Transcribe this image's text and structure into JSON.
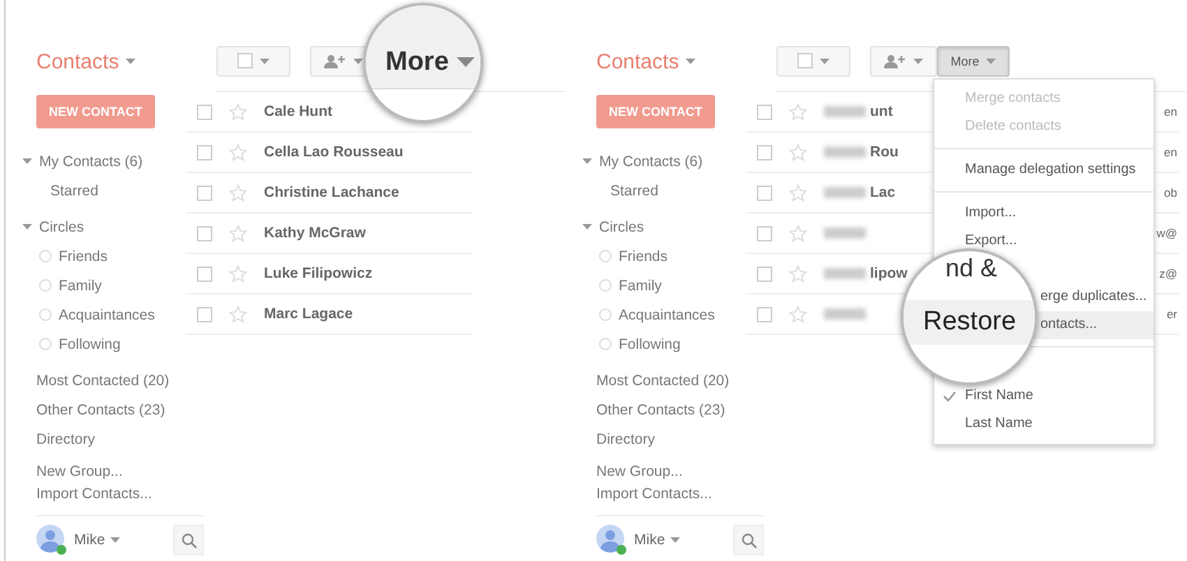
{
  "panels": [
    {
      "logo": "Contacts",
      "new_contact": "NEW CONTACT",
      "sidebar": [
        {
          "kind": "group",
          "label": "My Contacts (6)",
          "expanded": true
        },
        {
          "kind": "sub",
          "label": "Starred"
        },
        {
          "kind": "group",
          "label": "Circles",
          "expanded": true
        },
        {
          "kind": "circle",
          "label": "Friends"
        },
        {
          "kind": "circle",
          "label": "Family"
        },
        {
          "kind": "circle",
          "label": "Acquaintances"
        },
        {
          "kind": "circle",
          "label": "Following"
        },
        {
          "kind": "link",
          "label": "Most Contacted (20)"
        },
        {
          "kind": "link",
          "label": "Other Contacts (23)"
        },
        {
          "kind": "link",
          "label": "Directory"
        },
        {
          "kind": "action",
          "label": "New Group..."
        },
        {
          "kind": "action",
          "label": "Import Contacts..."
        }
      ],
      "user": {
        "name": "Mike",
        "online": true
      },
      "contacts": [
        {
          "name": "Cale Hunt",
          "checked": false,
          "starred": false,
          "blurred": false
        },
        {
          "name": "Cella Lao Rousseau",
          "checked": false,
          "starred": false,
          "blurred": false
        },
        {
          "name": "Christine Lachance",
          "checked": false,
          "starred": false,
          "blurred": false
        },
        {
          "name": "Kathy McGraw",
          "checked": false,
          "starred": false,
          "blurred": false
        },
        {
          "name": "Luke Filipowicz",
          "checked": false,
          "starred": false,
          "blurred": false
        },
        {
          "name": "Marc Lagace",
          "checked": false,
          "starred": false,
          "blurred": false
        }
      ],
      "lens": {
        "kind": "button",
        "text": "More"
      }
    },
    {
      "logo": "Contacts",
      "new_contact": "NEW CONTACT",
      "sidebar": [
        {
          "kind": "group",
          "label": "My Contacts (6)",
          "expanded": true
        },
        {
          "kind": "sub",
          "label": "Starred"
        },
        {
          "kind": "group",
          "label": "Circles",
          "expanded": true
        },
        {
          "kind": "circle",
          "label": "Friends"
        },
        {
          "kind": "circle",
          "label": "Family"
        },
        {
          "kind": "circle",
          "label": "Acquaintances"
        },
        {
          "kind": "circle",
          "label": "Following"
        },
        {
          "kind": "link",
          "label": "Most Contacted (20)"
        },
        {
          "kind": "link",
          "label": "Other Contacts (23)"
        },
        {
          "kind": "link",
          "label": "Directory"
        },
        {
          "kind": "action",
          "label": "New Group..."
        },
        {
          "kind": "action",
          "label": "Import Contacts..."
        }
      ],
      "user": {
        "name": "Mike",
        "online": true
      },
      "contacts": [
        {
          "name": "unt",
          "column_2": "en",
          "checked": false,
          "starred": false,
          "blurred": true
        },
        {
          "name": "Rou",
          "column_2": "en",
          "checked": false,
          "starred": false,
          "blurred": true
        },
        {
          "name": "Lac",
          "column_2": "ob",
          "checked": false,
          "starred": false,
          "blurred": true
        },
        {
          "column_2": "w@",
          "checked": false,
          "starred": false,
          "blurred": true
        },
        {
          "name": "lipow",
          "column_2": "z@",
          "checked": false,
          "starred": false,
          "blurred": true
        },
        {
          "column_2": "er",
          "checked": false,
          "starred": false,
          "blurred": true
        }
      ],
      "more_button": {
        "label": "More",
        "pressed": true
      },
      "menu": {
        "items": [
          {
            "kind": "item",
            "label": "Merge contacts",
            "disabled": true
          },
          {
            "kind": "item",
            "label": "Delete contacts",
            "disabled": true
          },
          {
            "kind": "divider"
          },
          {
            "kind": "item",
            "label": "Manage delegation settings",
            "disabled": false
          },
          {
            "kind": "divider"
          },
          {
            "kind": "item",
            "label": "Import...",
            "disabled": false
          },
          {
            "kind": "item",
            "label": "Export...",
            "disabled": false
          },
          {
            "kind": "gap"
          },
          {
            "kind": "partial",
            "label": "erge duplicates...",
            "disabled": false
          },
          {
            "kind": "partial",
            "label": "ontacts...",
            "disabled": false,
            "highlighted": true
          },
          {
            "kind": "divider"
          }
        ],
        "sort_options": [
          {
            "label": "First Name",
            "checked": true
          },
          {
            "label": "Last Name",
            "checked": false
          }
        ]
      },
      "lens": {
        "kind": "menu",
        "top_text": "nd &",
        "text": "Restore"
      }
    }
  ]
}
